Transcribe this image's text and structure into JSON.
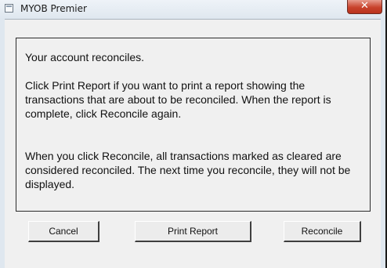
{
  "window": {
    "title": "MYOB Premier",
    "close_glyph": "✕"
  },
  "message": {
    "line1": "Your account reconciles.",
    "paragraph2": "Click Print Report if you want to print a report showing the transactions that are about to be reconciled.  When the report is complete, click Reconcile again.",
    "paragraph3": "When you click Reconcile, all transactions marked as cleared are considered reconciled.  The next time you reconcile, they will not be displayed."
  },
  "buttons": {
    "cancel": "Cancel",
    "print_report": "Print Report",
    "reconcile": "Reconcile"
  },
  "icons": {
    "app": "window-icon",
    "close": "close-icon"
  },
  "colors": {
    "close_button": "#c8432d",
    "dialog_background": "#f0f0f0"
  }
}
